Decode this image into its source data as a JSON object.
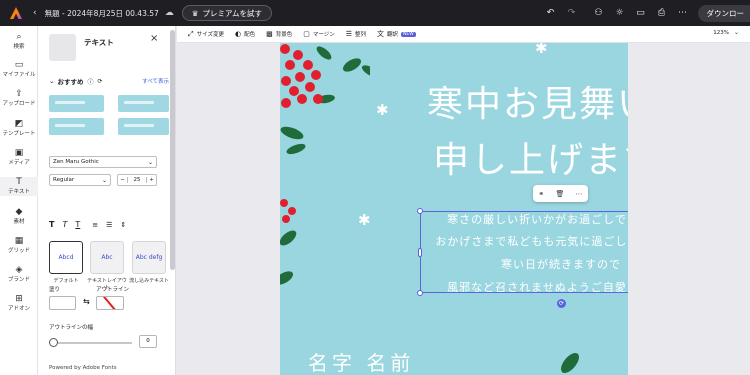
{
  "topbar": {
    "back_glyph": "‹",
    "doc_title": "無題 - 2024年8月25日 00.43.57",
    "premium_label": "プレミアムを試す",
    "download_label": "ダウンロー",
    "icons": [
      "undo-icon",
      "redo-icon",
      "user-icon",
      "lightbulb-icon",
      "comment-icon",
      "print-icon",
      "more-icon"
    ]
  },
  "rail": {
    "items": [
      {
        "label": "検索",
        "icon": "⌕"
      },
      {
        "label": "マイファイル",
        "icon": "▭"
      },
      {
        "label": "アップロード",
        "icon": "⇪"
      },
      {
        "label": "テンプレート",
        "icon": "◩"
      },
      {
        "label": "メディア",
        "icon": "▣"
      },
      {
        "label": "テキスト",
        "icon": "T"
      },
      {
        "label": "素材",
        "icon": "◆"
      },
      {
        "label": "グリッド",
        "icon": "▦"
      },
      {
        "label": "ブランド",
        "icon": "◈"
      },
      {
        "label": "アドオン",
        "icon": "⊞"
      }
    ]
  },
  "panel": {
    "title": "テキスト",
    "close": "×",
    "recommended": "おすすめ",
    "see_all": "すべて表示",
    "font_family": "Zen Maru Gothic",
    "font_weight": "Regular",
    "font_size": "25",
    "minus": "−",
    "plus": "+",
    "styles": [
      {
        "label": "デフォルト",
        "preview": "Abcd"
      },
      {
        "label": "テキストレイアウト",
        "preview": "Abc"
      },
      {
        "label": "流し込みテキスト",
        "preview": "Abc defg"
      }
    ],
    "fill_label": "塗り",
    "outline_label": "アウトライン",
    "outline_width_label": "アウトラインの幅",
    "outline_width_value": "0",
    "powered_by": "Powered by Adobe Fonts"
  },
  "context_toolbar": {
    "items": [
      {
        "label": "サイズ変更",
        "icon": "⤢"
      },
      {
        "label": "配色",
        "icon": "◐"
      },
      {
        "label": "背景色",
        "icon": "▩"
      },
      {
        "label": "マージン",
        "icon": "▢"
      },
      {
        "label": "整列",
        "icon": "☰"
      },
      {
        "label": "翻訳",
        "icon": "文",
        "badge": "NEW"
      }
    ],
    "zoom": "123%"
  },
  "canvas": {
    "heading_line1": "寒中お見舞い",
    "heading_line2": "申し上げます",
    "body_lines": [
      "寒さの厳しい折いかがお過ごしでしょうか",
      "おかげさまで私どもも元気に過ごしております",
      "寒い日が続きますので",
      "風邪など召されませぬようご自愛ください"
    ],
    "name": "名字 名前",
    "colors": {
      "background": "#9ad6e0",
      "berry": "#e0202e",
      "leaf": "#1f6b3a",
      "selection": "#5a63e0"
    }
  }
}
